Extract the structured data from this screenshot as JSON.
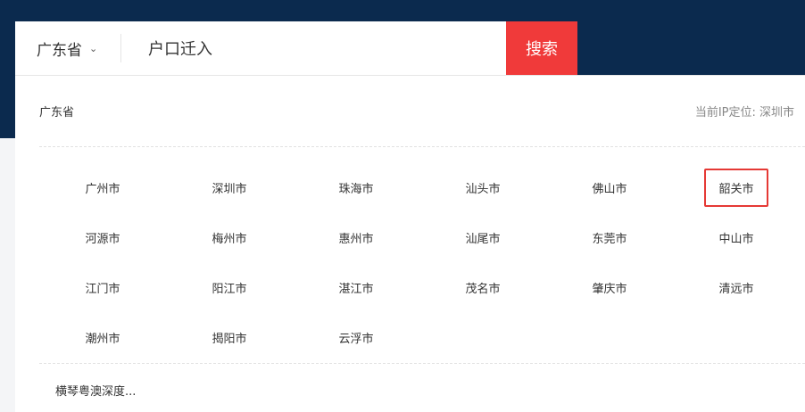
{
  "search": {
    "province": "广东省",
    "query": "户口迁入",
    "button": "搜索"
  },
  "panel": {
    "title": "广东省",
    "ip_location": "当前IP定位: 深圳市",
    "selected": "韶关市",
    "cities": [
      "广州市",
      "深圳市",
      "珠海市",
      "汕头市",
      "佛山市",
      "韶关市",
      "河源市",
      "梅州市",
      "惠州市",
      "汕尾市",
      "东莞市",
      "中山市",
      "江门市",
      "阳江市",
      "湛江市",
      "茂名市",
      "肇庆市",
      "清远市",
      "潮州市",
      "揭阳市",
      "云浮市"
    ],
    "extra": "横琴粤澳深度..."
  },
  "colors": {
    "header": "#0b2a4e",
    "accent": "#f03a3a"
  }
}
